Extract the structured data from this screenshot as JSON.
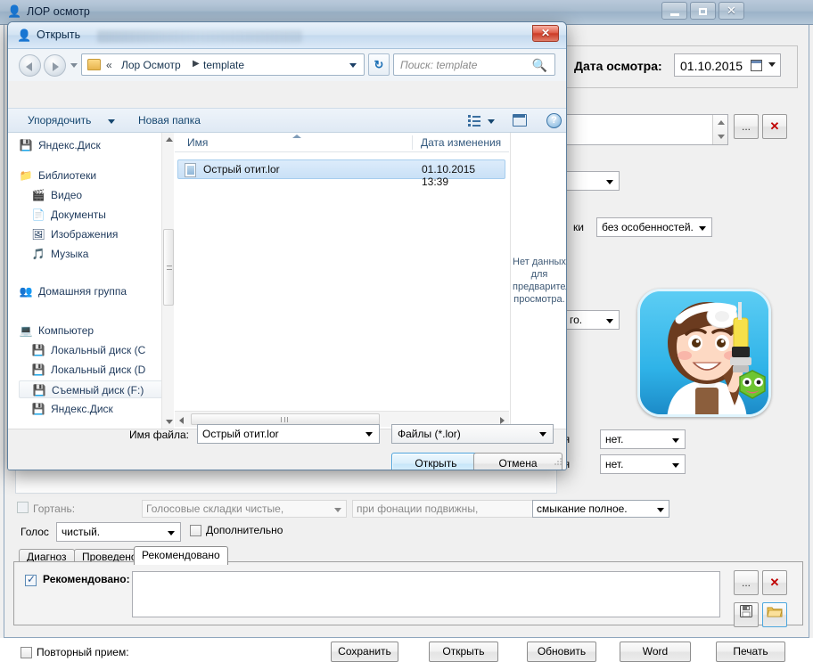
{
  "app": {
    "title": "ЛОР осмотр",
    "icon": "user-doctor-icon",
    "window_buttons": {
      "minimize": "minimize-icon",
      "maximize": "maximize-icon",
      "close": "✕"
    },
    "date_group": {
      "label": "Дата осмотра:",
      "value": "01.10.2015",
      "calendar_icon": "calendar-icon"
    },
    "small_buttons": {
      "ellipsis": "...",
      "red_x": "✕",
      "save_icon": "floppy-disk-icon",
      "folder_icon": "folder-icon"
    },
    "combos": {
      "empty_1": "",
      "feature": "без особенностей.",
      "feature_label_suffix": "ки",
      "other": "го.",
      "right_1_label": "ция",
      "right_1_value": "нет.",
      "right_2_label": "ция",
      "right_2_value": "нет."
    },
    "larynx_row": {
      "checkbox_label": "Гортань:",
      "field_1": "Голосовые складки чистые,",
      "field_2": "при фонации подвижны,",
      "field_3": "смыкание полное."
    },
    "voice_row": {
      "label": "Голос",
      "value": "чистый.",
      "extra_checkbox_label": "Дополнительно"
    },
    "tabs": [
      {
        "label": "Диагноз",
        "active": false
      },
      {
        "label": "Проведено",
        "active": false
      },
      {
        "label": "Рекомендовано",
        "active": true
      }
    ],
    "tab_panel": {
      "checkbox_label": "Рекомендовано:",
      "textarea_value": ""
    },
    "footer": {
      "repeat_checkbox_label": "Повторный прием:",
      "buttons": [
        "Сохранить",
        "Открыть",
        "Обновить",
        "Word",
        "Печать"
      ],
      "save": "Сохранить",
      "open": "Открыть",
      "refresh": "Обновить",
      "word": "Word",
      "print": "Печать"
    }
  },
  "dialog": {
    "title": "Открыть",
    "title_icon": "user-doctor-icon",
    "close_label": "✕",
    "nav": {
      "back_icon": "back-arrow-icon",
      "forward_icon": "forward-arrow-icon",
      "recent_icon": "chevron-down-icon",
      "folder_icon": "folder-icon",
      "chevron": "«",
      "segment_1": "Лор Осмотр",
      "separator": "▶",
      "segment_2": "template",
      "dropdown_icon": "chevron-down-icon",
      "refresh_icon": "↻"
    },
    "search": {
      "placeholder": "Поиск: template",
      "icon": "search-icon"
    },
    "toolbar": {
      "organize": "Упорядочить",
      "new_folder": "Новая папка",
      "view_icon": "list-view-icon",
      "preview_icon": "preview-pane-icon",
      "help_icon": "?"
    },
    "navpane": {
      "items": [
        {
          "label": "Яндекс.Диск",
          "icon": "disk-icon",
          "indent": false,
          "selected": false
        },
        {
          "label": "Библиотеки",
          "icon": "libraries-icon",
          "indent": false,
          "selected": false
        },
        {
          "label": "Видео",
          "icon": "video-icon",
          "indent": true,
          "selected": false
        },
        {
          "label": "Документы",
          "icon": "documents-icon",
          "indent": true,
          "selected": false
        },
        {
          "label": "Изображения",
          "icon": "images-icon",
          "indent": true,
          "selected": false
        },
        {
          "label": "Музыка",
          "icon": "music-icon",
          "indent": true,
          "selected": false
        },
        {
          "label": "Домашняя группа",
          "icon": "homegroup-icon",
          "indent": false,
          "selected": false
        },
        {
          "label": "Компьютер",
          "icon": "computer-icon",
          "indent": false,
          "selected": false
        },
        {
          "label": "Локальный диск (C",
          "icon": "harddrive-icon",
          "indent": true,
          "selected": false
        },
        {
          "label": "Локальный диск (D",
          "icon": "harddrive-icon",
          "indent": true,
          "selected": false
        },
        {
          "label": "Съемный диск (F:)",
          "icon": "removable-drive-icon",
          "indent": true,
          "selected": true
        },
        {
          "label": "Яндекс.Диск",
          "icon": "disk-icon",
          "indent": true,
          "selected": false
        }
      ]
    },
    "filelist": {
      "columns": [
        "Имя",
        "Дата изменения"
      ],
      "rows": [
        {
          "name": "Острый отит.lor",
          "modified": "01.10.2015 13:39",
          "selected": true,
          "icon": "document-icon"
        }
      ]
    },
    "preview": {
      "text": "Нет данных для предварительного просмотра."
    },
    "footer": {
      "filename_label": "Имя файла:",
      "filename_value": "Острый отит.lor",
      "filetype_value": "Файлы (*.lor)",
      "open_button": "Открыть",
      "cancel_button": "Отмена"
    }
  },
  "colors": {
    "accent_blue": "#4aa3dd",
    "selection_blue": "#c9e0f6",
    "close_red": "#cc3b26",
    "link_blue": "#15466f",
    "red_x": "#c00000"
  }
}
